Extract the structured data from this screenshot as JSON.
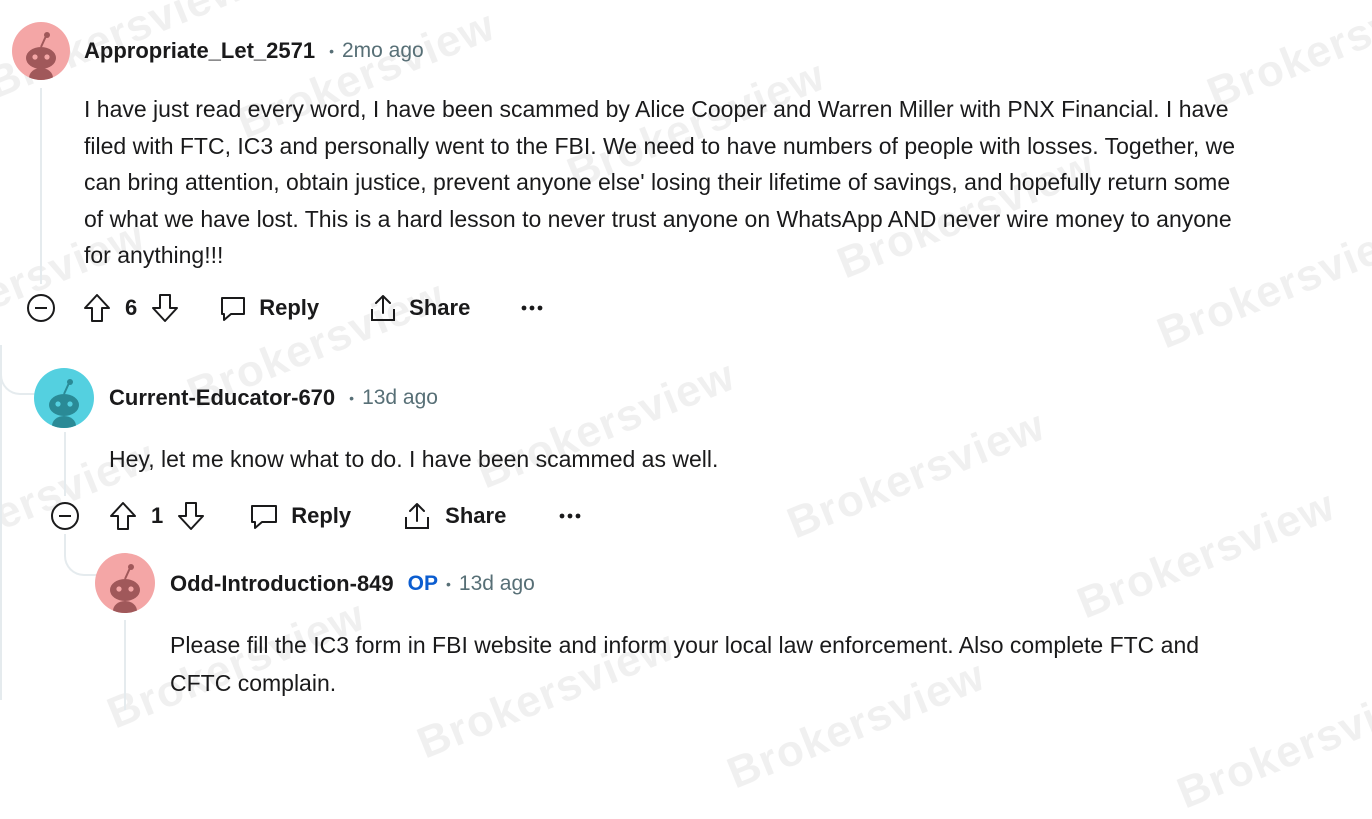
{
  "comments": [
    {
      "username": "Appropriate_Let_2571",
      "time": "2mo ago",
      "avatar_color": "#f4a6a6",
      "body_lines": [
        "I have just read every word, I have been scammed by Alice Cooper and Warren Miller with PNX Financial. I have",
        "filed with FTC, IC3 and personally went to the FBI. We need to have numbers of people with losses. Together, we",
        "can bring attention, obtain justice, prevent anyone else' losing their lifetime of savings, and hopefully return some",
        "of what we have lost. This is a hard lesson to never trust anyone on WhatsApp AND never wire money to anyone",
        "for anything!!!"
      ],
      "votes": "6",
      "reply_label": "Reply",
      "share_label": "Share"
    },
    {
      "username": "Current-Educator-670",
      "time": "13d ago",
      "avatar_color": "#54d0e0",
      "body_lines": [
        "Hey, let me know what to do. I have been scammed as well."
      ],
      "votes": "1",
      "reply_label": "Reply",
      "share_label": "Share"
    },
    {
      "username": "Odd-Introduction-849",
      "op_badge": "OP",
      "time": "13d ago",
      "avatar_color": "#f4a6a6",
      "body_lines": [
        "Please fill the IC3 form in FBI website and inform your local law enforcement. Also complete FTC and",
        "CFTC complain."
      ]
    }
  ],
  "separator": "•",
  "watermark_text": "Brokersview",
  "colors": {
    "meta": "#576f76",
    "op": "#0b5dd0",
    "thread": "#e5ebee"
  },
  "icons": [
    "collapse-icon",
    "upvote-icon",
    "downvote-icon",
    "comment-icon",
    "share-icon",
    "overflow-icon"
  ]
}
